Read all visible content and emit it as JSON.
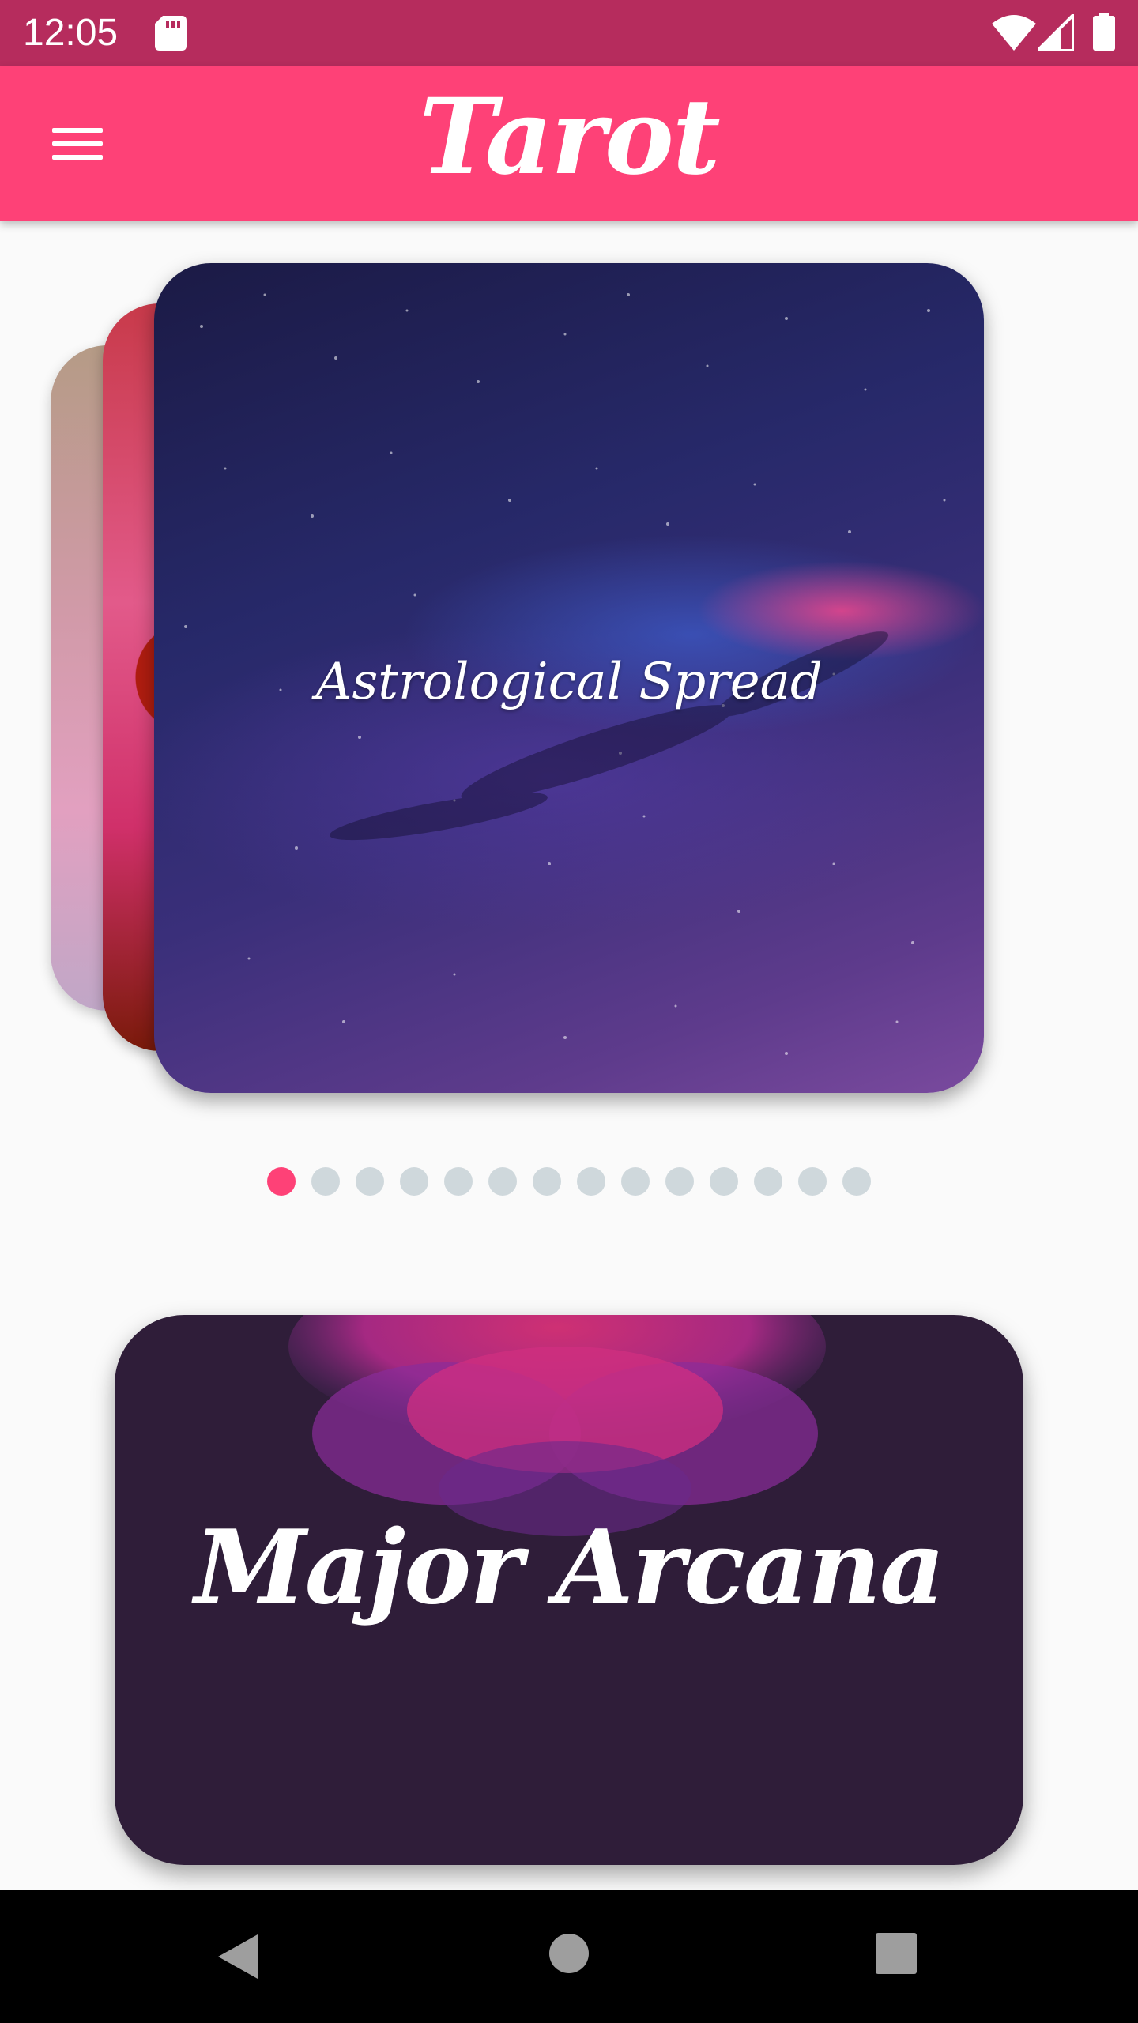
{
  "status_bar": {
    "time": "12:05",
    "icons": [
      "sd-card-icon",
      "wifi-icon",
      "signal-icon",
      "battery-icon"
    ]
  },
  "app_bar": {
    "title": "Tarot",
    "menu_icon": "hamburger-menu-icon",
    "color": "#fe4177"
  },
  "carousel": {
    "cards": [
      {
        "label": "Astrological Spread",
        "position": "front"
      },
      {
        "label": "",
        "position": "behind-1"
      },
      {
        "label": "",
        "position": "behind-2"
      }
    ],
    "page_count": 14,
    "active_page": 1
  },
  "major_card": {
    "title": "Major Arcana",
    "color": "#2f1d39"
  },
  "nav_bar": {
    "icons": [
      "back-icon",
      "home-icon",
      "recents-icon"
    ]
  },
  "colors": {
    "status_bar": "#b62c5d",
    "accent": "#fe4177",
    "dot_inactive": "#cfd8dc",
    "background": "#fafafa"
  }
}
